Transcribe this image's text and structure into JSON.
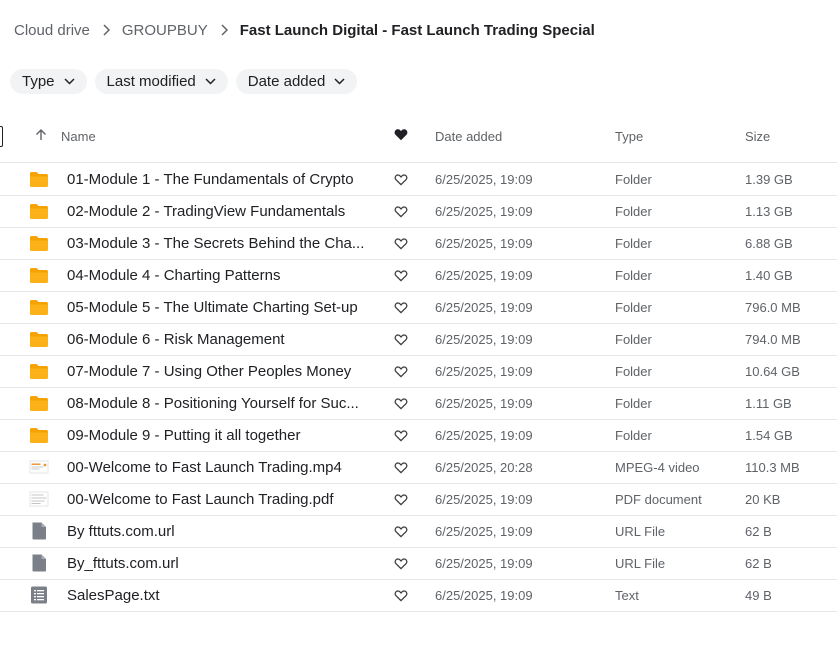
{
  "breadcrumb": {
    "items": [
      "Cloud drive",
      "GROUPBUY"
    ],
    "current": "Fast Launch Digital - Fast Launch Trading Special"
  },
  "filters": [
    {
      "label": "Type"
    },
    {
      "label": "Last modified"
    },
    {
      "label": "Date added"
    }
  ],
  "table": {
    "headers": {
      "name": "Name",
      "favorite": "heart-icon",
      "date_added": "Date added",
      "type": "Type",
      "size": "Size"
    },
    "rows": [
      {
        "name": "01-Module 1 - The Fundamentals of Crypto",
        "icon": "folder-icon",
        "date": "6/25/2025, 19:09",
        "type": "Folder",
        "size": "1.39 GB"
      },
      {
        "name": "02-Module 2 - TradingView Fundamentals",
        "icon": "folder-icon",
        "date": "6/25/2025, 19:09",
        "type": "Folder",
        "size": "1.13 GB"
      },
      {
        "name": "03-Module 3 - The Secrets Behind the Cha...",
        "icon": "folder-icon",
        "date": "6/25/2025, 19:09",
        "type": "Folder",
        "size": "6.88 GB"
      },
      {
        "name": "04-Module 4 - Charting Patterns",
        "icon": "folder-icon",
        "date": "6/25/2025, 19:09",
        "type": "Folder",
        "size": "1.40 GB"
      },
      {
        "name": "05-Module 5 - The Ultimate Charting Set-up",
        "icon": "folder-icon",
        "date": "6/25/2025, 19:09",
        "type": "Folder",
        "size": "796.0 MB"
      },
      {
        "name": "06-Module 6 - Risk Management",
        "icon": "folder-icon",
        "date": "6/25/2025, 19:09",
        "type": "Folder",
        "size": "794.0 MB"
      },
      {
        "name": "07-Module 7 - Using Other Peoples Money",
        "icon": "folder-icon",
        "date": "6/25/2025, 19:09",
        "type": "Folder",
        "size": "10.64 GB"
      },
      {
        "name": "08-Module 8 - Positioning Yourself for Suc...",
        "icon": "folder-icon",
        "date": "6/25/2025, 19:09",
        "type": "Folder",
        "size": "1.11 GB"
      },
      {
        "name": "09-Module 9 - Putting it all together",
        "icon": "folder-icon",
        "date": "6/25/2025, 19:09",
        "type": "Folder",
        "size": "1.54 GB"
      },
      {
        "name": "00-Welcome to Fast Launch Trading.mp4",
        "icon": "video-thumbnail-icon",
        "date": "6/25/2025, 20:28",
        "type": "MPEG-4 video",
        "size": "110.3 MB"
      },
      {
        "name": "00-Welcome to Fast Launch Trading.pdf",
        "icon": "pdf-thumbnail-icon",
        "date": "6/25/2025, 19:09",
        "type": "PDF document",
        "size": "20 KB"
      },
      {
        "name": "By fttuts.com.url",
        "icon": "generic-file-icon",
        "date": "6/25/2025, 19:09",
        "type": "URL File",
        "size": "62 B"
      },
      {
        "name": "By_fttuts.com.url",
        "icon": "generic-file-icon",
        "date": "6/25/2025, 19:09",
        "type": "URL File",
        "size": "62 B"
      },
      {
        "name": "SalesPage.txt",
        "icon": "text-file-icon",
        "date": "6/25/2025, 19:09",
        "type": "Text",
        "size": "49 B"
      }
    ]
  },
  "colors": {
    "folder": "#fbb117",
    "folder_tab": "#f5a300",
    "file_gray": "#7b8088",
    "text_primary": "#202124",
    "text_secondary": "#5f6368",
    "chip_bg": "#f1f3f4",
    "divider": "#e8e8e8"
  }
}
